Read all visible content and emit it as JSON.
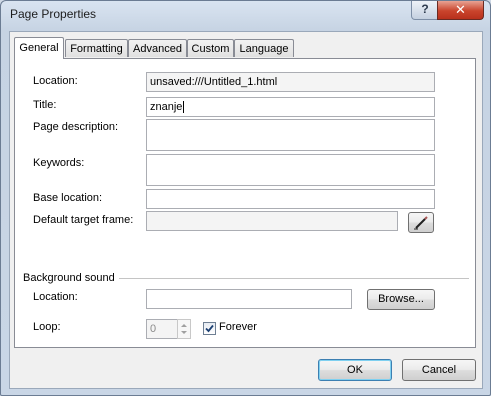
{
  "window": {
    "title": "Page Properties",
    "help_glyph": "?",
    "close_glyph": "✕"
  },
  "tabs": [
    {
      "label": "General",
      "active": true
    },
    {
      "label": "Formatting"
    },
    {
      "label": "Advanced"
    },
    {
      "label": "Custom"
    },
    {
      "label": "Language"
    }
  ],
  "general": {
    "location_label": "Location:",
    "location_value": "unsaved:///Untitled_1.html",
    "title_label": "Title:",
    "title_value": "znanje",
    "description_label": "Page description:",
    "description_value": "",
    "keywords_label": "Keywords:",
    "keywords_value": "",
    "base_location_label": "Base location:",
    "base_location_value": "",
    "target_frame_label": "Default target frame:",
    "target_frame_value": ""
  },
  "background_sound": {
    "section_label": "Background sound",
    "location_label": "Location:",
    "location_value": "",
    "browse_label": "Browse...",
    "loop_label": "Loop:",
    "loop_value": "0",
    "forever_label": "Forever",
    "forever_checked": true
  },
  "buttons": {
    "ok": "OK",
    "cancel": "Cancel"
  },
  "icons": {
    "pencil": "pencil-icon",
    "check": "checkmark-icon",
    "spin_up": "spin-up-icon",
    "spin_down": "spin-down-icon"
  }
}
